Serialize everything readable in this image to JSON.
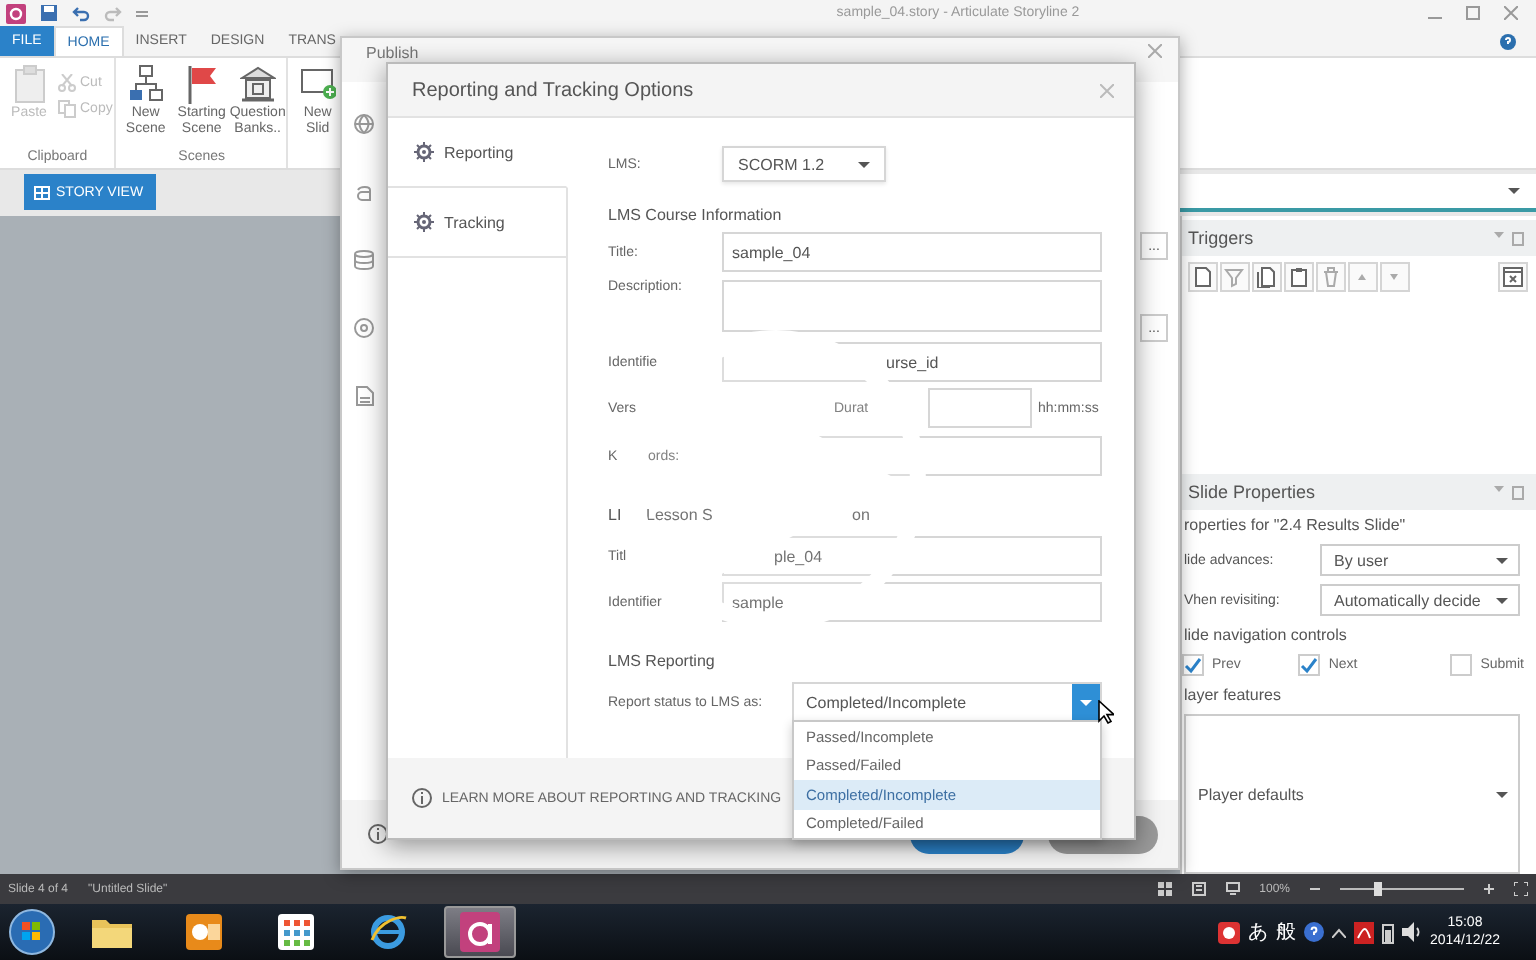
{
  "app": {
    "title": "sample_04.story - Articulate Storyline 2",
    "ribbon_tabs": [
      {
        "label": "FILE",
        "kind": "file",
        "selected": false
      },
      {
        "label": "HOME",
        "kind": "tab",
        "selected": true
      },
      {
        "label": "INSERT",
        "kind": "tab",
        "selected": false
      },
      {
        "label": "DESIGN",
        "kind": "tab",
        "selected": false
      },
      {
        "label": "TRANS",
        "kind": "tab",
        "selected": false
      }
    ],
    "ribbon_groups": [
      {
        "label": "Clipboard",
        "buttons": [
          {
            "label": "Paste",
            "kind": "large",
            "disabled": true
          },
          {
            "label": "Cut",
            "kind": "small",
            "disabled": true
          },
          {
            "label": "Copy",
            "kind": "small",
            "disabled": true
          }
        ]
      },
      {
        "label": "Scenes",
        "buttons": [
          {
            "label": "New Scene",
            "kind": "large",
            "disabled": false
          },
          {
            "label": "Starting Scene",
            "kind": "large",
            "disabled": false
          },
          {
            "label": "Question Banks..",
            "kind": "large",
            "disabled": false
          }
        ]
      },
      {
        "buttons": [
          {
            "label": "New Slid",
            "kind": "large"
          }
        ]
      }
    ],
    "view_tab": {
      "label": "STORY VIEW",
      "selected": true
    }
  },
  "publish": {
    "title": "Publish",
    "more_buttons": [
      "...",
      "..."
    ]
  },
  "dialog": {
    "title": "Reporting and Tracking Options",
    "nav": [
      {
        "label": "Reporting",
        "selected": true
      },
      {
        "label": "Tracking",
        "selected": false
      }
    ],
    "form": [
      {
        "kind": "select",
        "label": "LMS:",
        "value": "SCORM 1.2"
      },
      {
        "kind": "heading",
        "parts": [
          "LMS Course Information"
        ]
      },
      {
        "kind": "field",
        "label": "Title:",
        "value": "sample_04"
      },
      {
        "kind": "area",
        "label": "Description:"
      },
      {
        "kind": "tail_field",
        "label": "Identifie",
        "value": "urse_id"
      },
      {
        "kind": "duration",
        "label": "Vers",
        "label_2": "Durat",
        "unit": "hh:mm:ss"
      },
      {
        "kind": "split_field",
        "parts": [
          "K",
          "ords:"
        ]
      },
      {
        "kind": "heading",
        "parts": [
          "LI",
          "Lesson S",
          "on"
        ]
      },
      {
        "kind": "tail_field",
        "label": "Titl",
        "value": "ple_04"
      },
      {
        "kind": "field",
        "label": "Identifier",
        "value": "sample"
      },
      {
        "kind": "heading",
        "parts": [
          "LMS Reporting"
        ]
      },
      {
        "kind": "combo",
        "label": "Report status to LMS as:",
        "value": "Completed/Incomplete",
        "expanded": true,
        "options": [
          {
            "label": "Passed/Incomplete",
            "selected": false
          },
          {
            "label": "Passed/Failed",
            "selected": false
          },
          {
            "label": "Completed/Incomplete",
            "selected": true
          },
          {
            "label": "Completed/Failed",
            "selected": false
          }
        ]
      }
    ],
    "footer_link": "LEARN MORE ABOUT REPORTING AND TRACKING"
  },
  "right_panel": {
    "triggers_title": "Triggers",
    "slide_properties": {
      "title": "Slide Properties",
      "subtitle": "roperties for \"2.4 Results Slide\"",
      "rows": [
        {
          "label": "lide advances:",
          "value": "By user"
        },
        {
          "label": "Vhen revisiting:",
          "value": "Automatically decide"
        }
      ],
      "nav_heading": "lide navigation controls",
      "checkboxes": [
        {
          "label": "Prev",
          "checked": true
        },
        {
          "label": "Next",
          "checked": true
        },
        {
          "label": "Submit",
          "checked": false
        }
      ],
      "player_heading": "layer features",
      "player_value": "Player defaults"
    }
  },
  "status_bar": {
    "slide": "Slide 4 of 4",
    "slide_name": "\"Untitled Slide\"",
    "zoom": "100%",
    "zoom_slider": {
      "level": 0.3
    }
  },
  "taskbar": {
    "apps": [
      {
        "kind": "folder",
        "active": false
      },
      {
        "kind": "mail",
        "active": false
      },
      {
        "kind": "grid",
        "active": false
      },
      {
        "kind": "browser",
        "active": false
      },
      {
        "kind": "authoring",
        "active": true
      }
    ],
    "ime": [
      "あ",
      "般"
    ],
    "time": "15:08",
    "date": "2014/12/22"
  }
}
